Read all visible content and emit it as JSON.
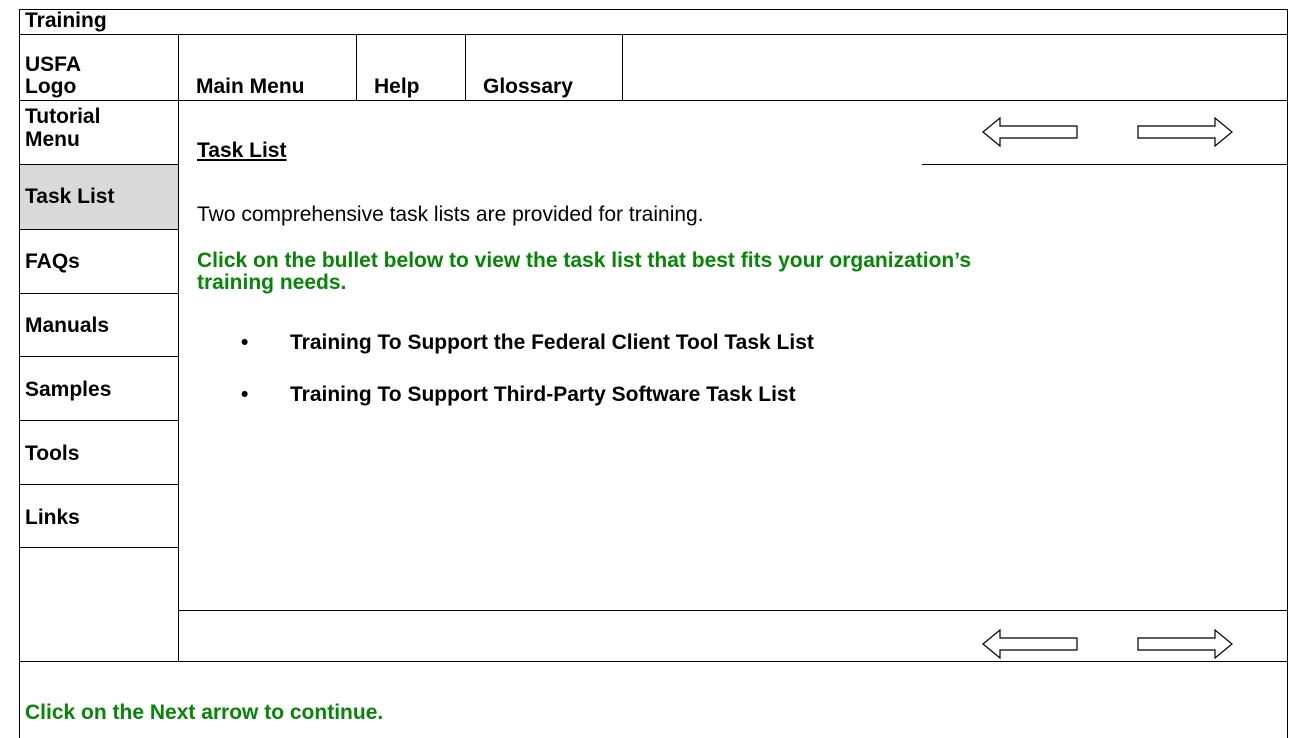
{
  "header": {
    "title": "Training",
    "logo_line1": "USFA",
    "logo_line2": "Logo",
    "menu": [
      "Main Menu",
      "Help",
      "Glossary"
    ]
  },
  "sidebar": {
    "heading_line1": "Tutorial",
    "heading_line2": "Menu",
    "items": [
      {
        "label": "Task List",
        "selected": true
      },
      {
        "label": "FAQs"
      },
      {
        "label": "Manuals"
      },
      {
        "label": "Samples"
      },
      {
        "label": "Tools"
      },
      {
        "label": "Links"
      }
    ]
  },
  "main": {
    "page_title": "Task List",
    "intro": "Two comprehensive task lists are provided for training.",
    "instruction_line1": "Click on the bullet below to view the task list that best fits your organization’s",
    "instruction_line2": "training needs.",
    "bullets": [
      "Training To Support the Federal Client Tool Task List",
      "Training To Support Third-Party Software Task List"
    ]
  },
  "footer": {
    "instruction": "Click on the Next arrow to continue."
  },
  "icons": {
    "back": "left-arrow-icon",
    "next": "right-arrow-icon"
  },
  "colors": {
    "instruction_green": "#078507",
    "selected_bg": "#d9d9d9"
  }
}
